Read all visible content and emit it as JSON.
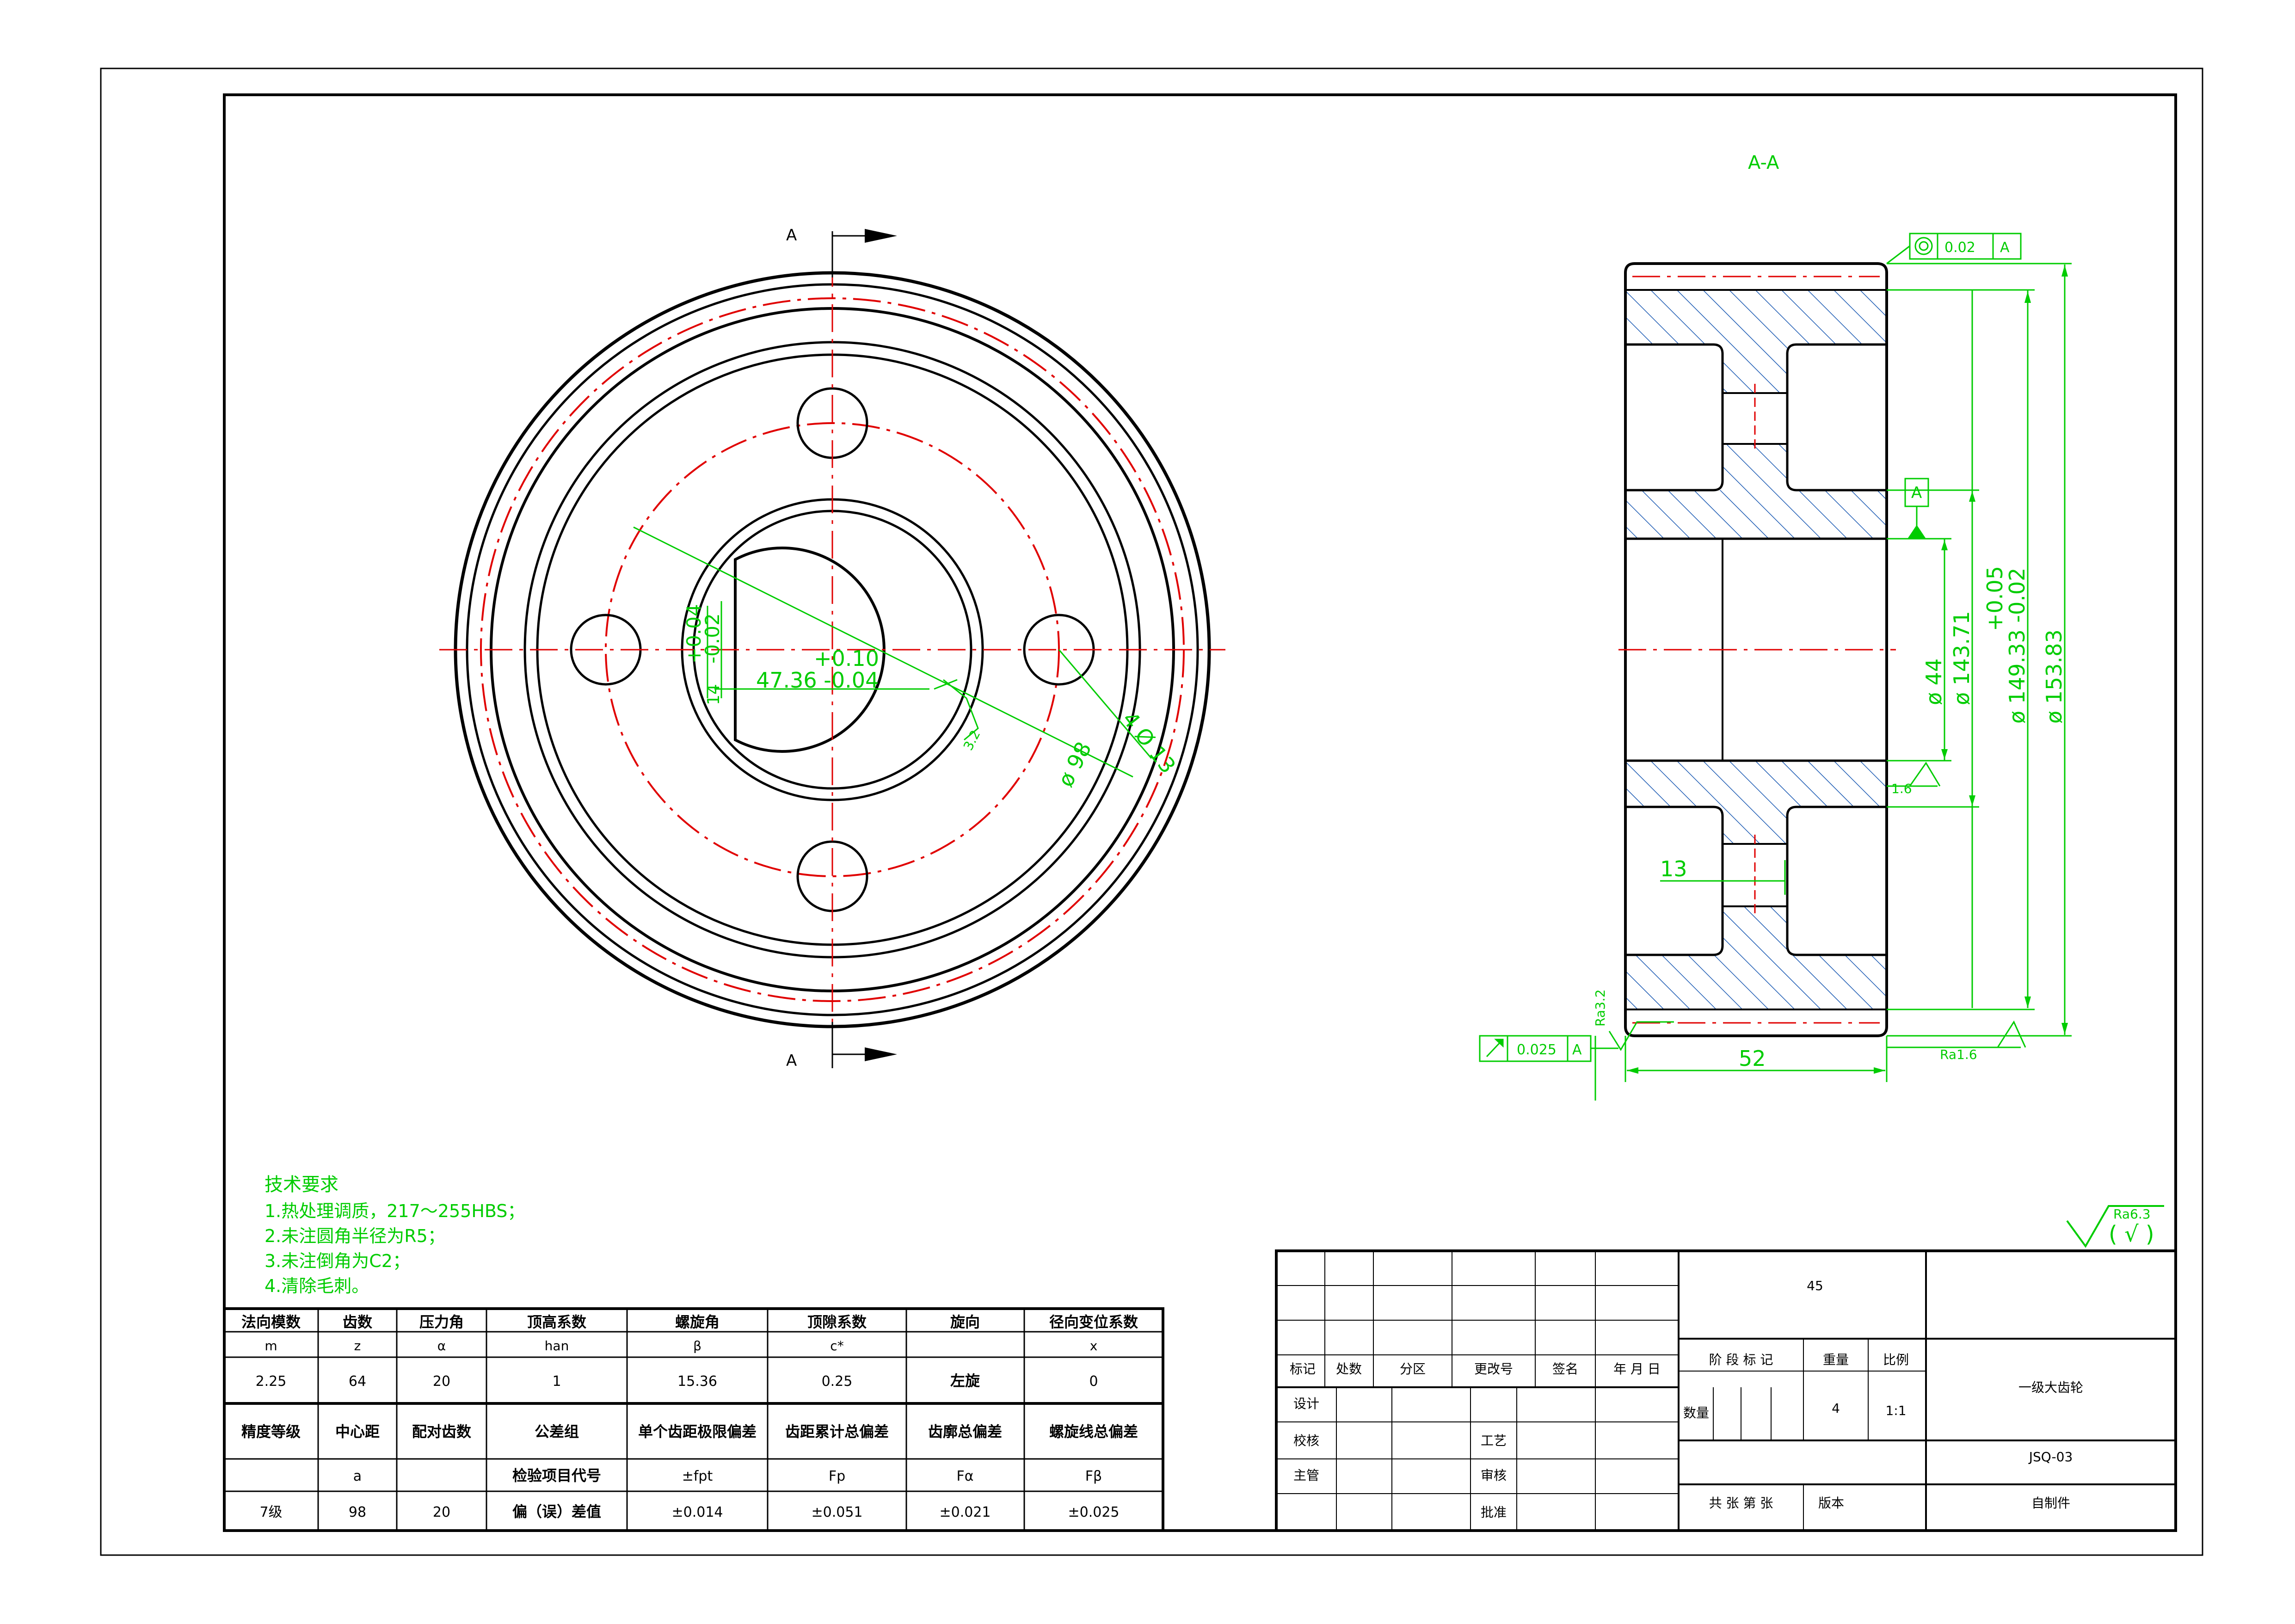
{
  "colors": {
    "outline": "#000000",
    "center_line": "#e00000",
    "dimension": "#00cc00",
    "hatch": "#1e5cb4"
  },
  "front_view": {
    "section_mark_top": "A",
    "section_mark_bottom": "A",
    "dim_keyway_tol_upper": "+0.04",
    "dim_keyway_tol_lower": "-0.02",
    "dim_keyway_sym": "14",
    "dim_keyway_depth_tol": "+0.10",
    "dim_keyway_depth": "47.36 -0.04",
    "dim_keyway_rough": "3.2",
    "dim_hole_dia": "4 Ø 13",
    "dim_bolt_circle": "ø 98"
  },
  "section_view": {
    "title": "A-A",
    "tol_frame_top": {
      "symbol": "concentricity-icon",
      "value": "0.02",
      "datum": "A"
    },
    "datum_label": "A",
    "dim_bore": "ø 44",
    "dim_hub": "ø 143.71",
    "dim_root_tol_upper": "+0.05",
    "dim_root": "ø 149.33 -0.02",
    "dim_outer": "ø 153.83",
    "dim_web": "13",
    "dim_width": "52",
    "rough_left": "Ra3.2",
    "rough_right_mid": "1.6",
    "rough_right_bottom": "Ra1.6",
    "tol_frame_bottom": {
      "symbol": "runout-icon",
      "value": "0.025",
      "datum": "A"
    }
  },
  "tech_requirements": {
    "title": "技术要求",
    "items": [
      "1.热处理调质，217～255HBS；",
      "2.未注圆角半径为R5；",
      "3.未注倒角为C2；",
      "4.清除毛刺。"
    ]
  },
  "general_roughness": {
    "value": "Ra6.3",
    "bracket": "( √ )"
  },
  "gear_table": {
    "row1": [
      "法向模数",
      "齿数",
      "压力角",
      "顶高系数",
      "螺旋角",
      "顶隙系数",
      "旋向",
      "径向变位系数"
    ],
    "row2": [
      "m",
      "z",
      "α",
      "han",
      "β",
      "c*",
      "",
      "x"
    ],
    "row3": [
      "2.25",
      "64",
      "20",
      "1",
      "15.36",
      "0.25",
      "左旋",
      "0"
    ],
    "row4": [
      "精度等级",
      "中心距",
      "配对齿数",
      "公差组",
      "单个齿距极限偏差",
      "齿距累计总偏差",
      "齿廓总偏差",
      "螺旋线总偏差"
    ],
    "row5": [
      "",
      "a",
      "",
      "检验项目代号",
      "±fpt",
      "Fp",
      "Fα",
      "Fβ"
    ],
    "row6": [
      "7级",
      "98",
      "20",
      "偏（误）差值",
      "±0.014",
      "±0.051",
      "±0.021",
      "±0.025"
    ]
  },
  "title_block": {
    "material": "45",
    "header": [
      "标记",
      "处数",
      "分区",
      "更改号",
      "签名",
      "年 月 日"
    ],
    "roles": [
      "设计",
      "校核",
      "主管"
    ],
    "roles_right": [
      "工艺",
      "审核",
      "批准"
    ],
    "stage_label": "阶 段 标 记",
    "weight_label": "重量",
    "scale_label": "比例",
    "quantity_label": "数量",
    "weight_value": "4",
    "scale_value": "1:1",
    "part_name": "一级大齿轮",
    "drawing_no": "JSQ-03",
    "sheets": "共  张     第  张",
    "version": "版本",
    "type": "自制件"
  }
}
